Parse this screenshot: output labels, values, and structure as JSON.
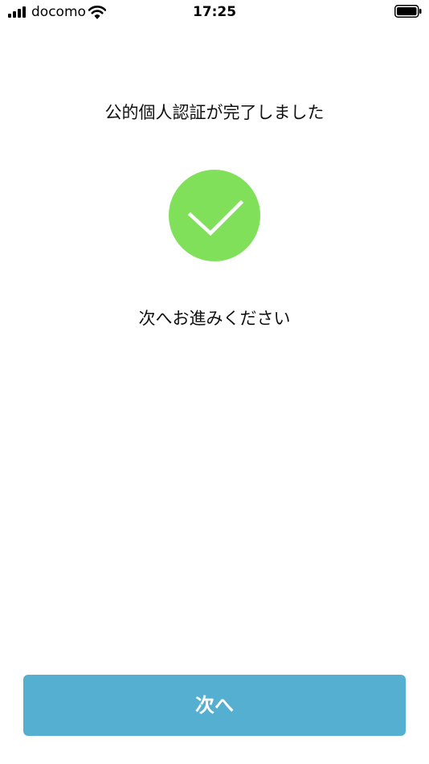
{
  "status_bar": {
    "carrier": "docomo",
    "time": "17:25"
  },
  "icons": {
    "signal": "cellular-signal-icon",
    "wifi": "wifi-icon",
    "battery": "battery-icon",
    "success": "checkmark-icon"
  },
  "colors": {
    "success_green": "#80e05a",
    "button_blue": "#54afd0"
  },
  "main": {
    "title": "公的個人認証が完了しました",
    "instruction": "次へお進みください"
  },
  "footer": {
    "next_label": "次へ"
  }
}
